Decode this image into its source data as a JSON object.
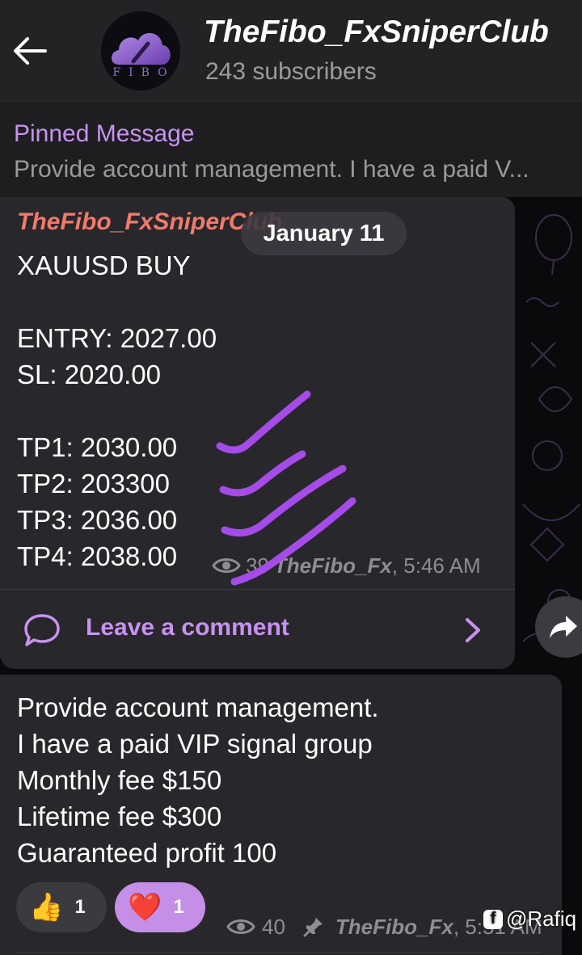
{
  "header": {
    "channel_name": "TheFibo_FxSniperClub",
    "subscribers": "243 subscribers",
    "avatar_text": "FIBO"
  },
  "pinned": {
    "label": "Pinned Message",
    "preview": "Provide account management. I have a paid V..."
  },
  "date_pill": "January 11",
  "message1": {
    "sender": "TheFibo_FxSniperClub",
    "lines": [
      "XAUUSD BUY",
      "ENTRY: 2027.00",
      "SL: 2020.00",
      "TP1: 2030.00",
      "TP2: 203300",
      "TP3: 2036.00",
      "TP4: 2038.00"
    ],
    "views": "39",
    "author": "TheFibo_Fx",
    "time": ", 5:46 AM",
    "comment_label": "Leave a comment"
  },
  "message2": {
    "lines": [
      "Provide account management.",
      "I have a paid VIP signal group",
      "Monthly fee $150",
      "Lifetime fee $300",
      "Guaranteed profit 100"
    ],
    "reactions": [
      {
        "emoji": "👍",
        "count": "1"
      },
      {
        "emoji": "❤️",
        "count": "1"
      }
    ],
    "views": "40",
    "author": "TheFibo_Fx",
    "time": ", 5:51 AM"
  },
  "watermark": "@Rafiq",
  "colors": {
    "accent": "#c792f0",
    "sender": "#f17a6a",
    "bubble": "#28272b",
    "header": "#232325",
    "scribble": "#a54be8"
  },
  "icons": [
    "back-arrow-icon",
    "eye-icon",
    "comment-icon",
    "chevron-right-icon",
    "share-icon",
    "pin-icon",
    "facebook-icon"
  ]
}
